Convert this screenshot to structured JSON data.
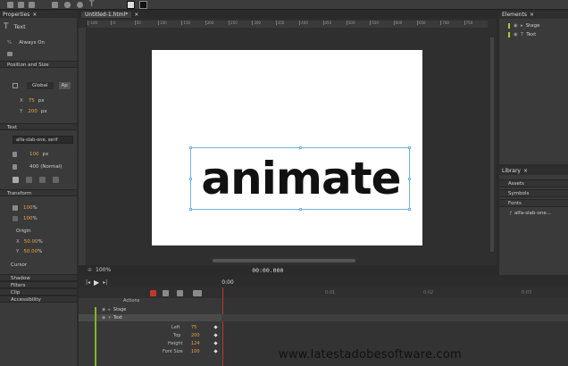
{
  "toolbar": {
    "icons": [
      "select-icon",
      "transform-icon",
      "pen-icon",
      "rect-icon",
      "rounded-rect-icon",
      "ellipse-icon",
      "text-icon"
    ]
  },
  "properties": {
    "title": "Properties",
    "close": "×",
    "element_type": "Text",
    "always_on": "Always On",
    "position_size": "Position and Size",
    "global": "Global",
    "applied": "Ap",
    "x_label": "X",
    "x_value": "75",
    "x_unit": "px",
    "y_label": "Y",
    "y_value": "200",
    "y_unit": "px",
    "text_section": "Text",
    "font": "alfa-slab-one, serif",
    "font_size": "100",
    "font_size_unit": "px",
    "font_weight": "400 (Normal)",
    "transform_section": "Transform",
    "scale_x": "100",
    "scale_y": "100",
    "percent": "%",
    "origin_label": "Origin",
    "origin_x": "50.00",
    "origin_y": "50.00",
    "cursor": "Cursor",
    "shadow": "Shadow",
    "filters": "Filters",
    "clip": "Clip",
    "accessibility": "Accessibility"
  },
  "document": {
    "tab": "Untitled-1.html*",
    "tab_close": "×",
    "stage_text": "animate",
    "zoom": "100%",
    "time": "00:00.000",
    "ruler": [
      "-100",
      "0",
      "50",
      "100",
      "150",
      "200",
      "250",
      "300",
      "350",
      "400",
      "450",
      "500",
      "550",
      "600",
      "650",
      "700",
      "750"
    ]
  },
  "elements": {
    "title": "Elements",
    "close": "×",
    "stage": "Stage",
    "text": "Text"
  },
  "library": {
    "title": "Library",
    "close": "×",
    "assets": "Assets",
    "symbols": "Symbols",
    "fonts": "Fonts",
    "font_item": "alfa-slab-one..."
  },
  "timeline": {
    "actions": "Actions",
    "stage": "Stage",
    "text": "Text",
    "time_start": "0:00",
    "marks": [
      "0:01",
      "0:02",
      "0:03",
      "0:04"
    ],
    "props": [
      {
        "name": "Left",
        "value": "75"
      },
      {
        "name": "Top",
        "value": "200"
      },
      {
        "name": "Height",
        "value": "124"
      },
      {
        "name": "Font Size",
        "value": "100"
      }
    ]
  },
  "watermark": "www.latestadobesoftware.com",
  "colors": {
    "accent_orange": "#e8a33b",
    "selection_blue": "#6fb3e0",
    "playhead_red": "#c0392b"
  }
}
